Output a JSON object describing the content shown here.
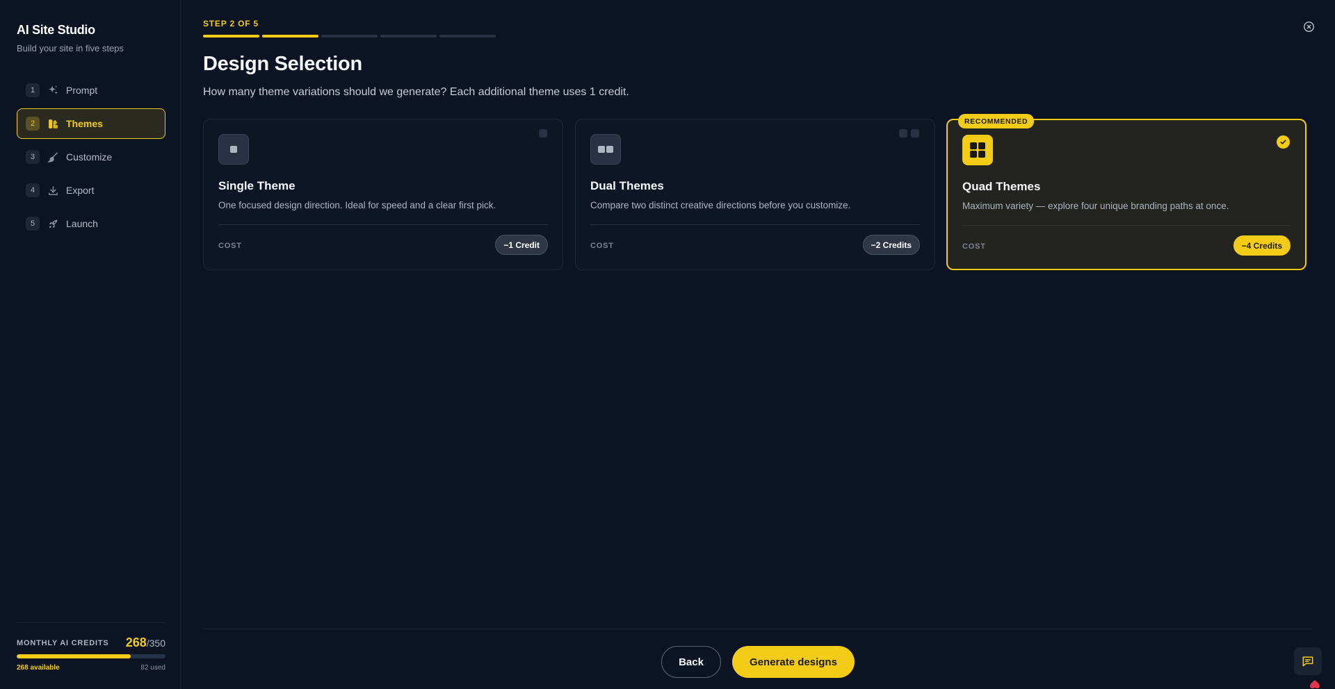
{
  "sidebar": {
    "brand_title": "AI Site Studio",
    "brand_subtitle": "Build your site in five steps",
    "steps": [
      {
        "num": "1",
        "label": "Prompt",
        "icon": "sparkles-icon",
        "active": false
      },
      {
        "num": "2",
        "label": "Themes",
        "icon": "palette-icon",
        "active": true
      },
      {
        "num": "3",
        "label": "Customize",
        "icon": "brush-icon",
        "active": false
      },
      {
        "num": "4",
        "label": "Export",
        "icon": "download-icon",
        "active": false
      },
      {
        "num": "5",
        "label": "Launch",
        "icon": "rocket-icon",
        "active": false
      }
    ],
    "credits": {
      "label": "MONTHLY AI CREDITS",
      "current": "268",
      "separator": "/",
      "total": "350",
      "available_text": "268 available",
      "used_text": "82 used",
      "fill_fraction": 0.766
    }
  },
  "header": {
    "step_indicator": "STEP 2 OF 5",
    "progress_total": 5,
    "progress_done": 2,
    "title": "Design Selection",
    "subtitle": "How many theme variations should we generate? Each additional theme uses 1 credit."
  },
  "options": [
    {
      "title": "Single Theme",
      "description": "One focused design direction. Ideal for speed and a clear first pick.",
      "cost_label": "COST",
      "cost": "−1 Credit",
      "selected": false
    },
    {
      "title": "Dual Themes",
      "description": "Compare two distinct creative directions before you customize.",
      "cost_label": "COST",
      "cost": "−2 Credits",
      "selected": false
    },
    {
      "title": "Quad Themes",
      "description": "Maximum variety — explore four unique branding paths at once.",
      "cost_label": "COST",
      "cost": "−4 Credits",
      "badge": "RECOMMENDED",
      "selected": true
    }
  ],
  "footer": {
    "back_label": "Back",
    "generate_label": "Generate designs"
  },
  "colors": {
    "accent": "#f3cc17",
    "background": "#0c1322",
    "card": "#0e1626",
    "selected_card": "#23231f"
  }
}
